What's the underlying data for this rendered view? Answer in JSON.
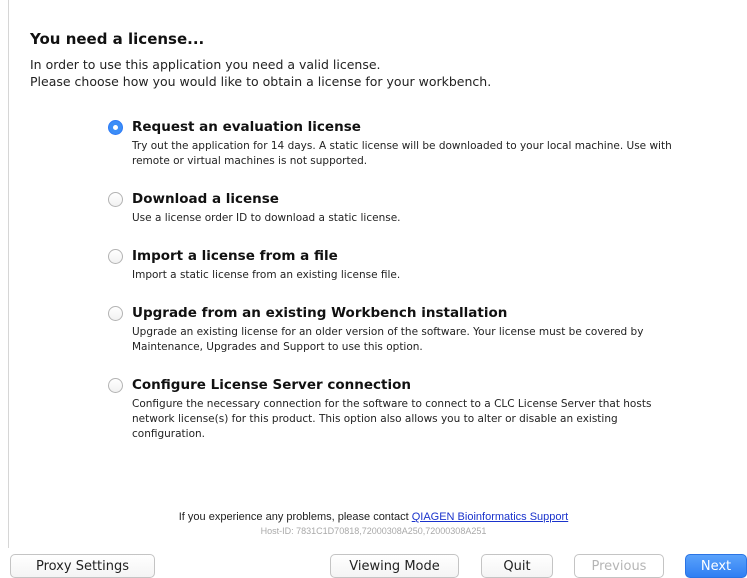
{
  "heading": "You need a license...",
  "intro": {
    "line1": "In order to use this application you need a valid license.",
    "line2": "Please choose how you would like to obtain a license for your workbench."
  },
  "options": [
    {
      "title": "Request an evaluation license",
      "desc": "Try out the application for 14 days. A static license will be downloaded to your local machine. Use with remote or virtual machines is not supported.",
      "selected": true
    },
    {
      "title": "Download a license",
      "desc": "Use a license order ID to download a static license.",
      "selected": false
    },
    {
      "title": "Import a license from a file",
      "desc": "Import a static license from an existing license file.",
      "selected": false
    },
    {
      "title": "Upgrade from an existing Workbench installation",
      "desc": "Upgrade an existing license for an older version of the software. Your license must be covered by Maintenance, Upgrades and Support to use this option.",
      "selected": false
    },
    {
      "title": "Configure License Server connection",
      "desc": "Configure the necessary connection for the software to connect to a CLC License Server that hosts network license(s) for this product. This option also allows you to alter or disable an existing configuration.",
      "selected": false
    }
  ],
  "footer": {
    "problem_text": "If you experience any problems, please contact ",
    "support_link": "QIAGEN Bioinformatics Support",
    "host_id": "Host-ID: 7831C1D70818,72000308A250,72000308A251"
  },
  "buttons": {
    "proxy": "Proxy Settings",
    "viewing_mode": "Viewing Mode",
    "quit": "Quit",
    "previous": "Previous",
    "next": "Next"
  },
  "colors": {
    "accent": "#3b8df7",
    "link": "#1a33cc"
  },
  "icons": {
    "radio_selected": "radio-selected-icon",
    "radio_unselected": "radio-unselected-icon"
  }
}
